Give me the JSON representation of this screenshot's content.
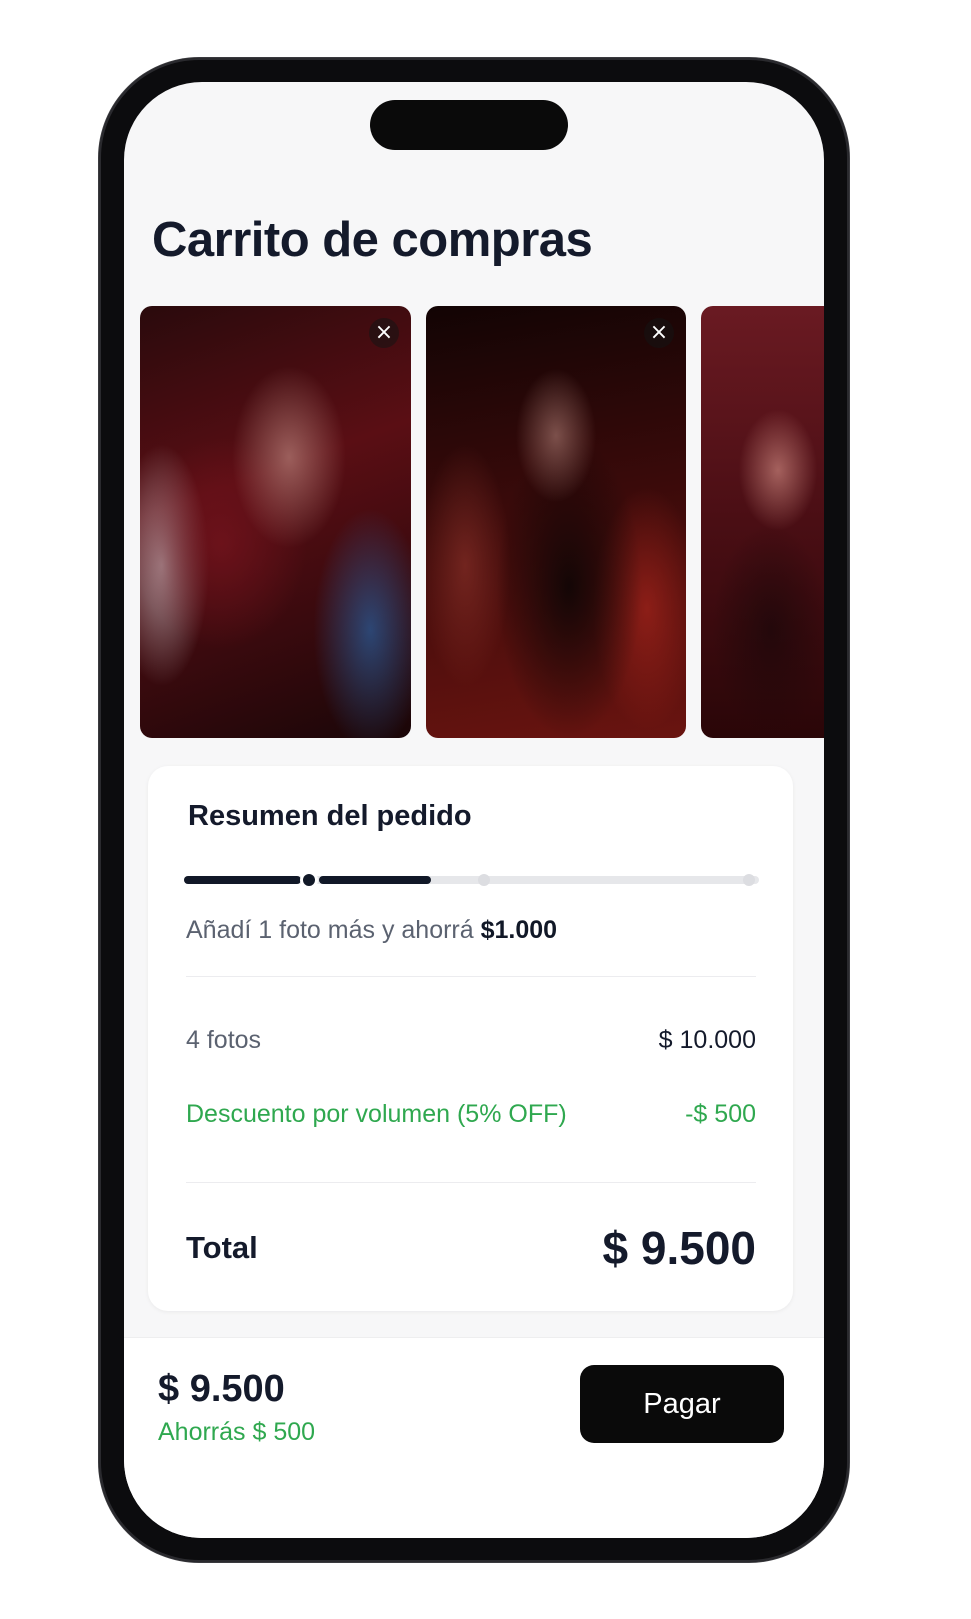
{
  "header": {
    "title": "Carrito de compras"
  },
  "photos": [
    {
      "remove_icon": "×"
    },
    {
      "remove_icon": "×"
    },
    {
      "remove_icon": ""
    }
  ],
  "summary": {
    "title": "Resumen del pedido",
    "progress": {
      "steps": 3,
      "completed_fraction": 0.43
    },
    "hint_prefix": "Añadí 1 foto más y ahorrá",
    "hint_amount": "$1.000",
    "items_label": "4 fotos",
    "items_value": "$ 10.000",
    "discount_label": "Descuento por volumen (5% OFF)",
    "discount_value": "-$ 500",
    "total_label": "Total",
    "total_value": "$ 9.500"
  },
  "footer": {
    "total": "$ 9.500",
    "savings": "Ahorrás $ 500",
    "pay_label": "Pagar"
  },
  "colors": {
    "text_dark": "#141a2b",
    "muted": "#5b6270",
    "discount_green": "#2fa84f",
    "button_bg": "#0a0a0a"
  }
}
